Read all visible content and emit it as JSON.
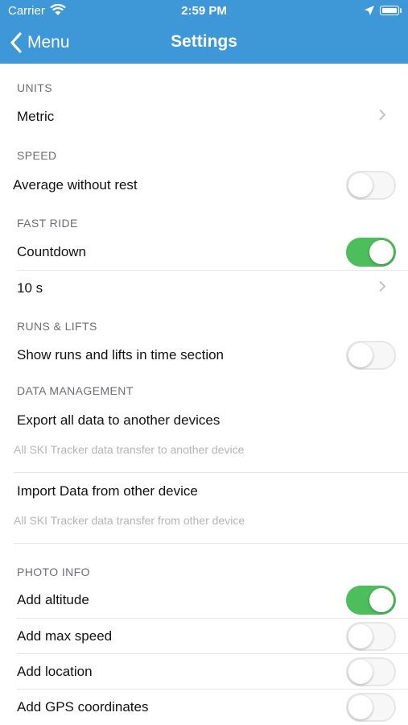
{
  "status_bar": {
    "carrier": "Carrier",
    "time": "2:59 PM"
  },
  "nav": {
    "back_label": "Menu",
    "title": "Settings"
  },
  "units": {
    "header": "UNITS",
    "value": "Metric"
  },
  "speed": {
    "header": "SPEED",
    "avg_label": "Average without rest",
    "avg_on": false
  },
  "fast_ride": {
    "header": "FAST RIDE",
    "countdown_label": "Countdown",
    "countdown_on": true,
    "countdown_value": "10 s"
  },
  "runs_lifts": {
    "header": "RUNS & LIFTS",
    "show_label": "Show runs and lifts in time section",
    "show_on": false
  },
  "data_management": {
    "header": "DATA MANAGEMENT",
    "export_label": "Export all data to another devices",
    "export_note": "All SKI Tracker data transfer to another device",
    "import_label": "Import Data from other device",
    "import_note": "All SKI Tracker data transfer from other device"
  },
  "photo_info": {
    "header": "PHOTO INFO",
    "altitude_label": "Add altitude",
    "altitude_on": true,
    "max_speed_label": "Add max speed",
    "max_speed_on": false,
    "location_label": "Add location",
    "location_on": false,
    "gps_label": "Add GPS coordinates",
    "gps_on": false
  },
  "colors": {
    "bar": "#3e97d6",
    "toggle_on": "#4cbe5b"
  }
}
